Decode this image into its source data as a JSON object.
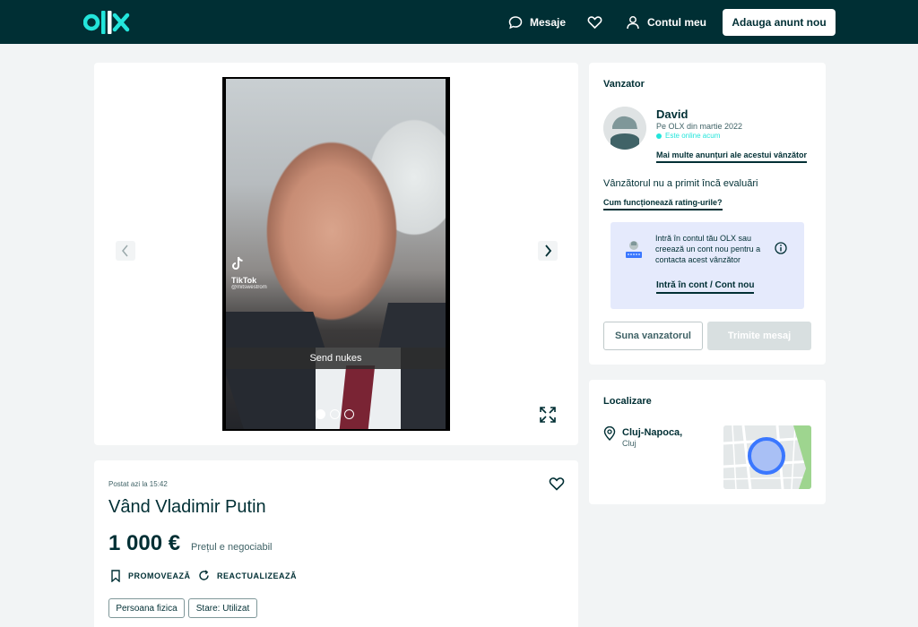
{
  "header": {
    "logo_text": "OLX",
    "messages_label": "Mesaje",
    "favorites_icon": "heart-icon",
    "account_label": "Contul meu",
    "post_ad_label": "Adauga anunt nou"
  },
  "gallery": {
    "tiktok_name": "TikTok",
    "tiktok_handle": "@mitswestrom",
    "caption": "Send nukes",
    "slide_count": 3,
    "active_slide": 1
  },
  "ad": {
    "posted": "Postat azi la 15:42",
    "title": "Vând Vladimir Putin",
    "price": "1 000 €",
    "negotiable": "Prețul e negociabil",
    "promote_label": "PROMOVEAZĂ",
    "refresh_label": "REACTUALIZEAZĂ",
    "tags": [
      "Persoana fizica",
      "Stare: Utilizat"
    ]
  },
  "seller": {
    "section_title": "Vanzator",
    "name": "David",
    "since": "Pe OLX din martie 2022",
    "online": "Este online acum",
    "more_ads_link": "Mai multe anunțuri ale acestui vânzător",
    "no_rating": "Vânzătorul nu a primit încă evaluări",
    "rating_link": "Cum funcționează rating-urile?",
    "login_prompt": "Intră în contul tău OLX sau creează un cont nou pentru a contacta acest vânzător",
    "login_link": "Intră în cont / Cont nou",
    "call_button": "Suna vanzatorul",
    "message_button": "Trimite mesaj"
  },
  "location": {
    "section_title": "Localizare",
    "city": "Cluj-Napoca,",
    "region": "Cluj"
  },
  "colors": {
    "brand_dark": "#002f34",
    "brand_accent": "#23e5db",
    "login_box": "#e5eafc"
  }
}
